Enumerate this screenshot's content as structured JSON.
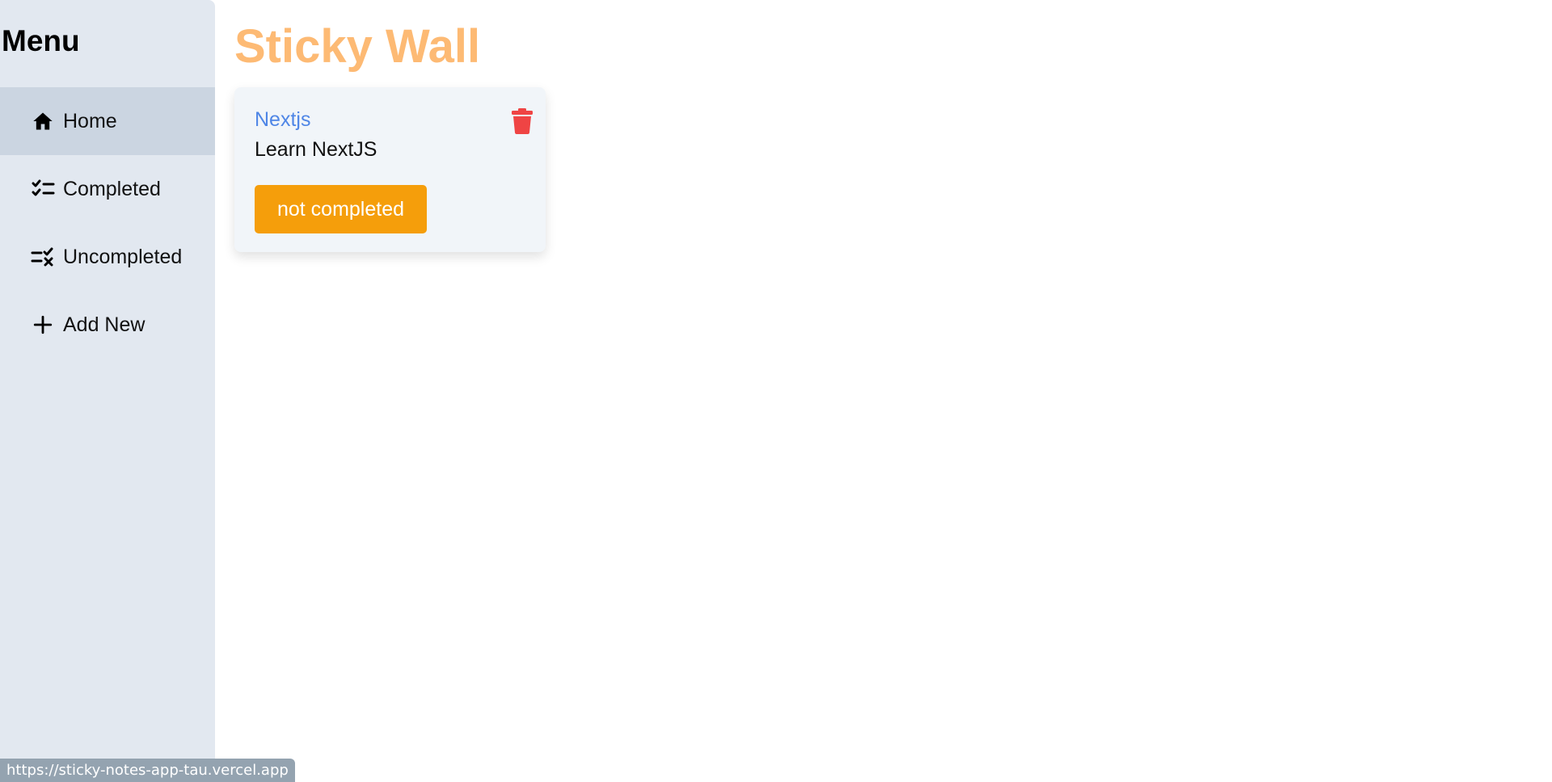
{
  "sidebar": {
    "title": "Menu",
    "items": [
      {
        "label": "Home",
        "icon": "home-icon",
        "active": true
      },
      {
        "label": "Completed",
        "icon": "checklist-icon",
        "active": false
      },
      {
        "label": "Uncompleted",
        "icon": "list-x-icon",
        "active": false
      },
      {
        "label": "Add New",
        "icon": "plus-icon",
        "active": false
      }
    ]
  },
  "main": {
    "title": "Sticky Wall",
    "notes": [
      {
        "title": "Nextjs",
        "description": "Learn NextJS",
        "status_label": "not completed"
      }
    ]
  },
  "status_bar": {
    "url": "https://sticky-notes-app-tau.vercel.app"
  },
  "colors": {
    "sidebar_bg": "#e2e8f0",
    "active_item_bg": "#cbd5e1",
    "title_orange": "#fdba74",
    "note_title_blue": "#4f86e6",
    "status_orange": "#f59e0b",
    "trash_red": "#ef4444",
    "card_bg": "#f1f5f9"
  }
}
